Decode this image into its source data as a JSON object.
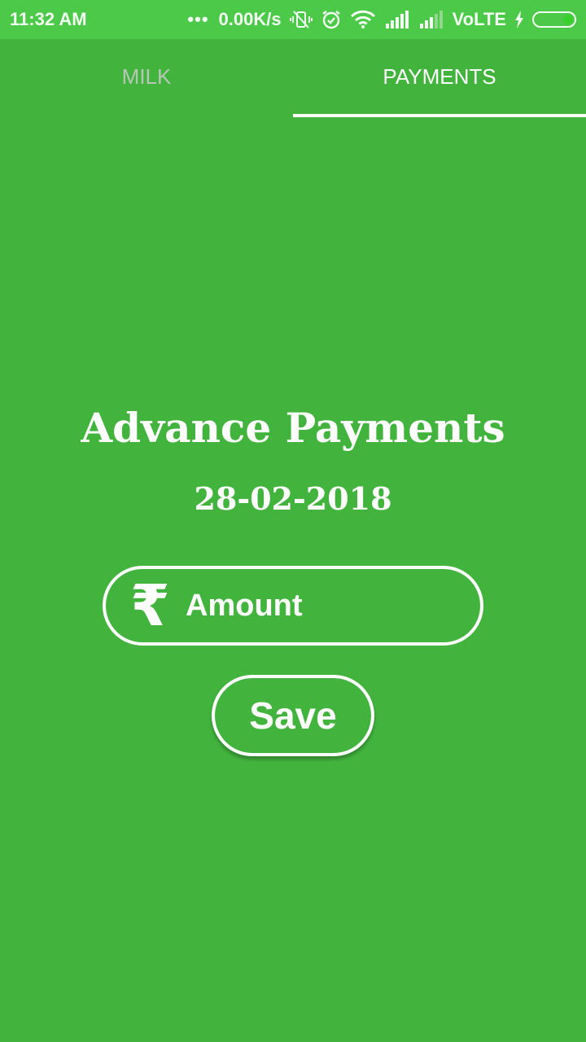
{
  "status_bar": {
    "time": "11:32 AM",
    "dots": "•••",
    "network_speed": "0.00K/s",
    "network_type": "VoLTE",
    "icons": [
      "vibrate-off-icon",
      "alarm-icon",
      "wifi-icon",
      "signal-icon",
      "signal-weak-icon",
      "charging-icon",
      "battery-icon"
    ]
  },
  "tabs": [
    {
      "label": "MILK",
      "active": false
    },
    {
      "label": "PAYMENTS",
      "active": true
    }
  ],
  "main": {
    "title": "Advance Payments",
    "date": "28-02-2018",
    "amount_field": {
      "icon": "rupee-icon",
      "icon_glyph": "₹",
      "placeholder": "Amount",
      "value": ""
    },
    "save_label": "Save"
  },
  "colors": {
    "background": "#42b43e",
    "status_bar": "#4cc948",
    "text": "#ffffff",
    "inactive_tab": "#b7c7b7"
  }
}
